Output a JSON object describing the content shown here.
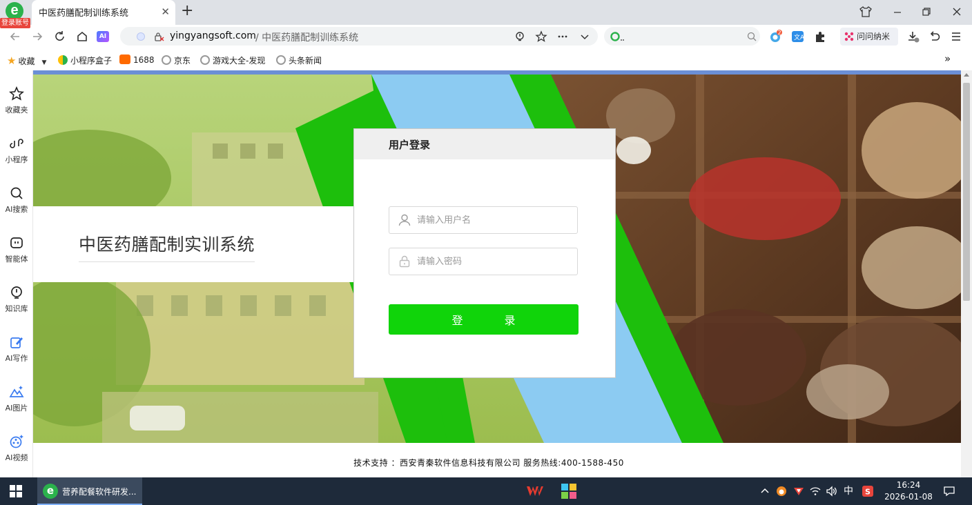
{
  "browser": {
    "login_badge": "登录账号",
    "tab_title": "中医药膳配制训练系统",
    "tab_close": "✕",
    "new_tab": "+",
    "url_domain": "yingyangsoft.com",
    "url_path": "/ 中医药膳配制训练系统",
    "wenwen_label": "问问纳米",
    "ai_badge": "AI",
    "ext_badge_count": "2"
  },
  "bookmarks": [
    {
      "label": "收藏",
      "icon": "star-icon",
      "color": "#f5a623"
    },
    {
      "label": "小程序盒子",
      "icon": "miniapp-icon",
      "color": "#2bb24c"
    },
    {
      "label": "1688",
      "icon": "1688-icon",
      "color": "#ff6a00"
    },
    {
      "label": "京东",
      "icon": "globe-icon",
      "color": "#888888"
    },
    {
      "label": "游戏大全-发现",
      "icon": "globe-icon",
      "color": "#888888"
    },
    {
      "label": "头条新闻",
      "icon": "globe-icon",
      "color": "#888888"
    }
  ],
  "sidebar": [
    {
      "label": "收藏夹",
      "icon": "star-outline-icon"
    },
    {
      "label": "小程序",
      "icon": "miniprogram-icon"
    },
    {
      "label": "AI搜索",
      "icon": "search-icon"
    },
    {
      "label": "智能体",
      "icon": "agent-icon"
    },
    {
      "label": "知识库",
      "icon": "knowledge-icon"
    },
    {
      "label": "AI写作",
      "icon": "write-icon"
    },
    {
      "label": "AI图片",
      "icon": "image-icon"
    },
    {
      "label": "AI视频",
      "icon": "video-icon"
    }
  ],
  "page": {
    "system_title": "中医药膳配制实训系统",
    "login_title": "用户登录",
    "username_placeholder": "请输入用户名",
    "password_placeholder": "请输入密码",
    "login_button": "登录",
    "footer": "技术支持 ：西安青秦软件信息科技有限公司 服务热线:400-1588-450"
  },
  "colors": {
    "accent_green": "#10d40a",
    "banner_green": "#1dbf0c",
    "banner_blue": "#8ccbf2"
  },
  "taskbar": {
    "app_label": "营养配餐软件研发...",
    "ime": "中",
    "time": "16:24",
    "date": "2026-01-08"
  }
}
